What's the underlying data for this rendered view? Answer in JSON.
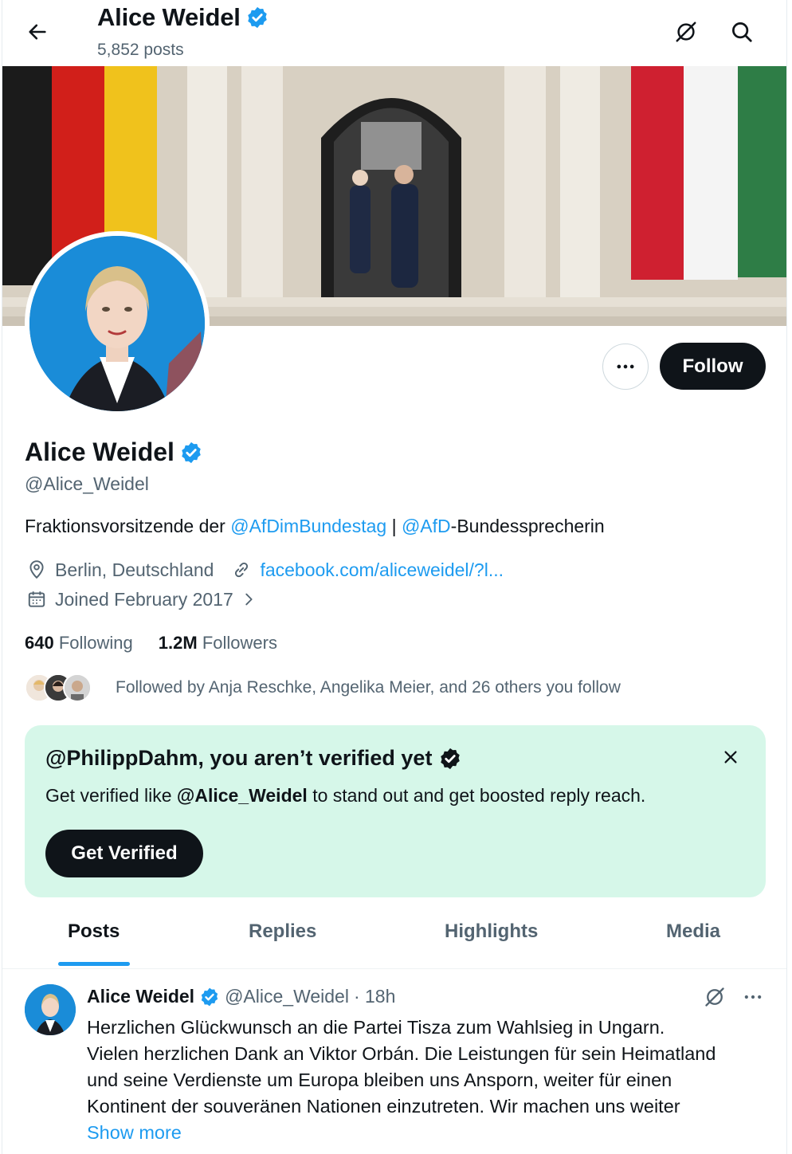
{
  "header": {
    "name": "Alice Weidel",
    "posts_count": "5,852 posts"
  },
  "profile": {
    "name": "Alice Weidel",
    "handle": "@Alice_Weidel",
    "bio": {
      "prefix": "Fraktionsvorsitzende der ",
      "mention1": "@AfDimBundestag",
      "separator": " | ",
      "mention2": "@AfD",
      "suffix": "-Bundessprecherin"
    },
    "location": "Berlin, Deutschland",
    "website": "facebook.com/aliceweidel/?l...",
    "joined": "Joined February 2017",
    "following_count": "640",
    "following_label": "Following",
    "followers_count": "1.2M",
    "followers_label": "Followers",
    "followed_by": "Followed by Anja Reschke, Angelika Meier, and 26 others you follow",
    "follow_label": "Follow"
  },
  "verify_card": {
    "title": "@PhilippDahm, you aren’t verified yet",
    "text_prefix": "Get verified like ",
    "text_handle": "@Alice_Weidel",
    "text_suffix": " to stand out and get boosted reply reach.",
    "button": "Get Verified"
  },
  "tabs": [
    {
      "label": "Posts",
      "active": true
    },
    {
      "label": "Replies",
      "active": false
    },
    {
      "label": "Highlights",
      "active": false
    },
    {
      "label": "Media",
      "active": false
    }
  ],
  "post": {
    "author": "Alice Weidel",
    "handle": "@Alice_Weidel",
    "time": "· 18h",
    "lines": [
      "Herzlichen Glückwunsch an die Partei Tisza zum Wahlsieg in Ungarn.",
      "Vielen herzlichen Dank an Viktor Orbán. Die Leistungen für sein Heimatland",
      "und seine Verdienste um Europa bleiben uns Ansporn, weiter für einen",
      "Kontinent der souveränen Nationen einzutreten. Wir machen uns weiter"
    ],
    "show_more": "Show more"
  },
  "colors": {
    "accent": "#1d9bf0",
    "verify_bg": "#d6f7e9",
    "text_secondary": "#536471"
  },
  "icons": {
    "back": "arrow-left-icon",
    "grok": "grok-icon",
    "search": "search-icon",
    "verified": "verified-badge-icon",
    "location": "location-pin-icon",
    "link": "link-icon",
    "calendar": "calendar-icon",
    "more": "more-horizontal-icon",
    "close": "close-icon"
  }
}
